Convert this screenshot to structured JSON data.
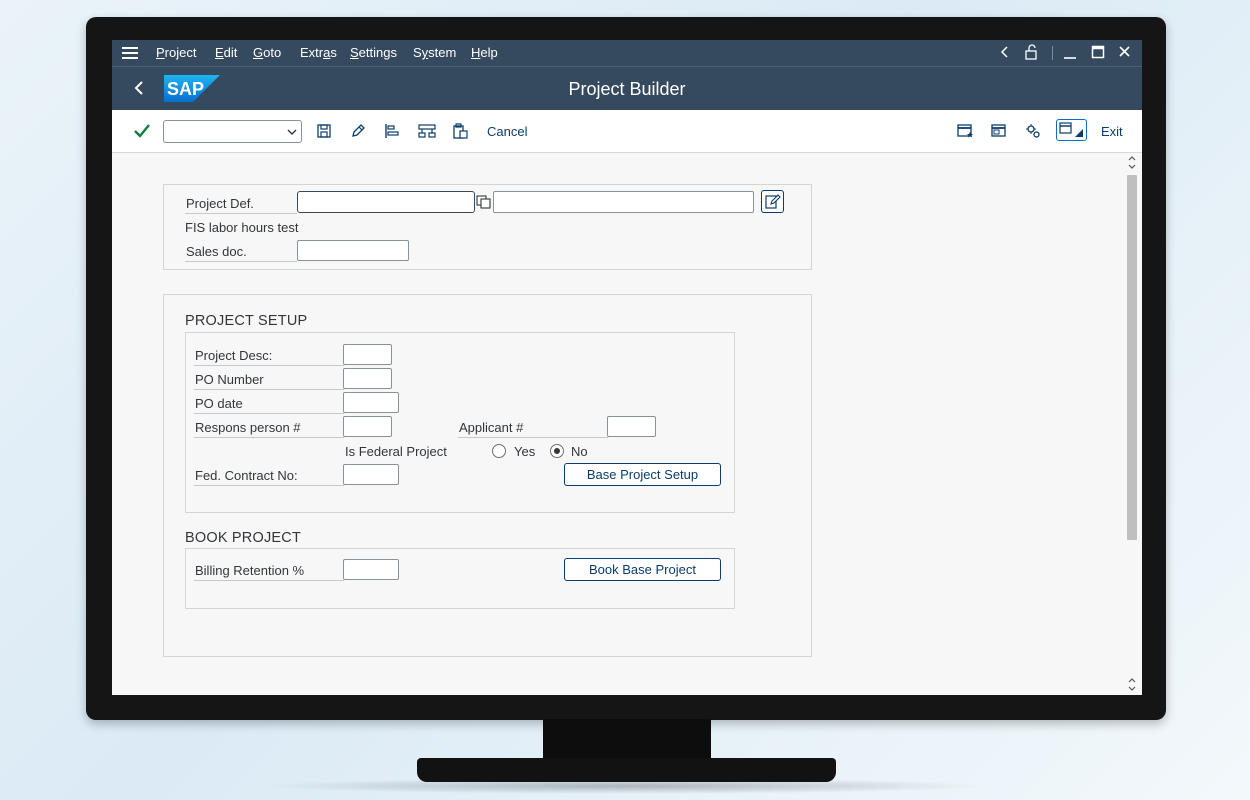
{
  "menu": {
    "items": [
      {
        "label": "Project",
        "underline": "P",
        "rest": "roject"
      },
      {
        "label": "Edit",
        "underline": "E",
        "rest": "dit"
      },
      {
        "label": "Goto",
        "underline": "G",
        "rest": "oto"
      },
      {
        "label": "Extras",
        "underline_pre": "Extr",
        "underline": "a",
        "rest": "s"
      },
      {
        "label": "Settings",
        "underline": "S",
        "rest": "ettings"
      },
      {
        "label": "System",
        "underline_pre": "S",
        "underline": "y",
        "rest": "stem"
      },
      {
        "label": "Help",
        "underline": "H",
        "rest": "elp"
      }
    ]
  },
  "title": {
    "app_title": "Project Builder",
    "logo_text": "SAP"
  },
  "toolbar": {
    "command_field_value": "",
    "cancel_label": "Cancel",
    "exit_label": "Exit",
    "icons": [
      "save-icon",
      "edit-icon",
      "align-icon",
      "hierarchy-icon",
      "clipboard-icon",
      "favorites-icon",
      "window-icon",
      "settings-icon",
      "layout-icon"
    ]
  },
  "header_panel": {
    "project_def_label": "Project Def.",
    "project_def_value": "",
    "project_desc_text": "FIS labor hours test",
    "sales_doc_label": "Sales doc.",
    "sales_doc_value": ""
  },
  "project_setup": {
    "title": "PROJECT SETUP",
    "project_desc_label": "Project Desc:",
    "po_number_label": "PO Number",
    "po_date_label": "PO date",
    "respons_person_label": "Respons person #",
    "applicant_label": "Applicant #",
    "is_federal_label": "Is Federal Project",
    "yes_label": "Yes",
    "no_label": "No",
    "is_federal_selected": "No",
    "fed_contract_label": "Fed. Contract No:",
    "base_setup_button": "Base Project Setup"
  },
  "book_project": {
    "title": "BOOK PROJECT",
    "billing_retention_label": "Billing Retention %",
    "book_button": "Book Base Project"
  },
  "colors": {
    "shell_header": "#354a5f",
    "accent": "#0a6ed1",
    "button_text": "#0a3d6b",
    "confirm_green": "#107e3e"
  }
}
